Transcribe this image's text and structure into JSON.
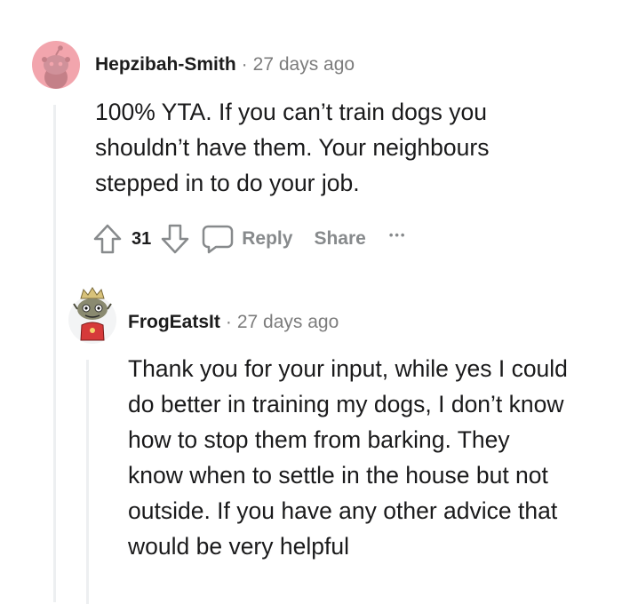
{
  "comment": {
    "author": "Hepzibah-Smith",
    "separator": "·",
    "time": "27 days ago",
    "text": "100% YTA. If you can’t train dogs you shouldn’t have them. Your neighbours stepped in to do your job.",
    "score": "31",
    "actions": {
      "reply": "Reply",
      "share": "Share",
      "more": "•••"
    },
    "avatar_color": "#f2a5ad"
  },
  "reply": {
    "author": "FrogEatsIt",
    "separator": "·",
    "time": "27 days ago",
    "text": "Thank you for your input, while yes I could do better in training my dogs, I don’t know how to stop them from barking. They know when to settle in the house but not outside. If you have any other advice that would be very helpful"
  },
  "colors": {
    "thread_line": "#edeff1",
    "meta_gray": "#7c7c7c",
    "action_gray": "#878a8c"
  }
}
